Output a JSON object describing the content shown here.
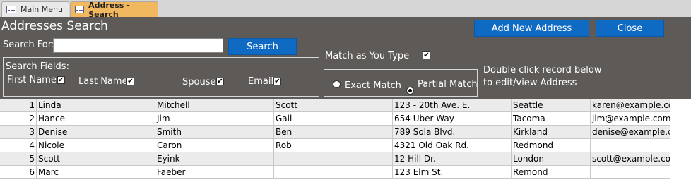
{
  "tabs": [
    {
      "label": "Main Menu",
      "active": false
    },
    {
      "label": "Address - Search",
      "active": true
    }
  ],
  "form": {
    "title": "Addresses Search",
    "add_button": "Add New Address",
    "close_button": "Close",
    "search_label": "Search For:",
    "search_value": "",
    "search_button": "Search",
    "match_as_you_type_label": "Match as You Type",
    "match_as_you_type_checked": true,
    "search_fields_label": "Search Fields:",
    "fields": [
      {
        "label": "First Name",
        "checked": true
      },
      {
        "label": "Last Name",
        "checked": true
      },
      {
        "label": "Spouse",
        "checked": true
      },
      {
        "label": "Email",
        "checked": true
      }
    ],
    "exact_match_label": "Exact Match",
    "partial_match_label": "Partial Match",
    "match_mode": "partial",
    "hint_line1": "Double click record below",
    "hint_line2": "to edit/view Address"
  },
  "records": [
    {
      "num": "1",
      "first": "Linda",
      "last": "Mitchell",
      "spouse": "Scott",
      "address": "123 - 20th Ave. E.",
      "city": "Seattle",
      "email": "karen@example.com"
    },
    {
      "num": "2",
      "first": "Hance",
      "last": "Jim",
      "spouse": "Gail",
      "address": "654 Uber Way",
      "city": "Tacoma",
      "email": "jim@example.com"
    },
    {
      "num": "3",
      "first": "Denise",
      "last": "Smith",
      "spouse": "Ben",
      "address": "789 Sola Blvd.",
      "city": "Kirkland",
      "email": "denise@example.com"
    },
    {
      "num": "4",
      "first": "Nicole",
      "last": "Caron",
      "spouse": "Rob",
      "address": "4321 Old Oak Rd.",
      "city": "Redmond",
      "email": ""
    },
    {
      "num": "5",
      "first": "Scott",
      "last": "Eyink",
      "spouse": "",
      "address": "12 Hill Dr.",
      "city": "London",
      "email": "scott@example.com"
    },
    {
      "num": "6",
      "first": "Marc",
      "last": "Faeber",
      "spouse": "",
      "address": "123 Elm St.",
      "city": "Remond",
      "email": ""
    }
  ]
}
